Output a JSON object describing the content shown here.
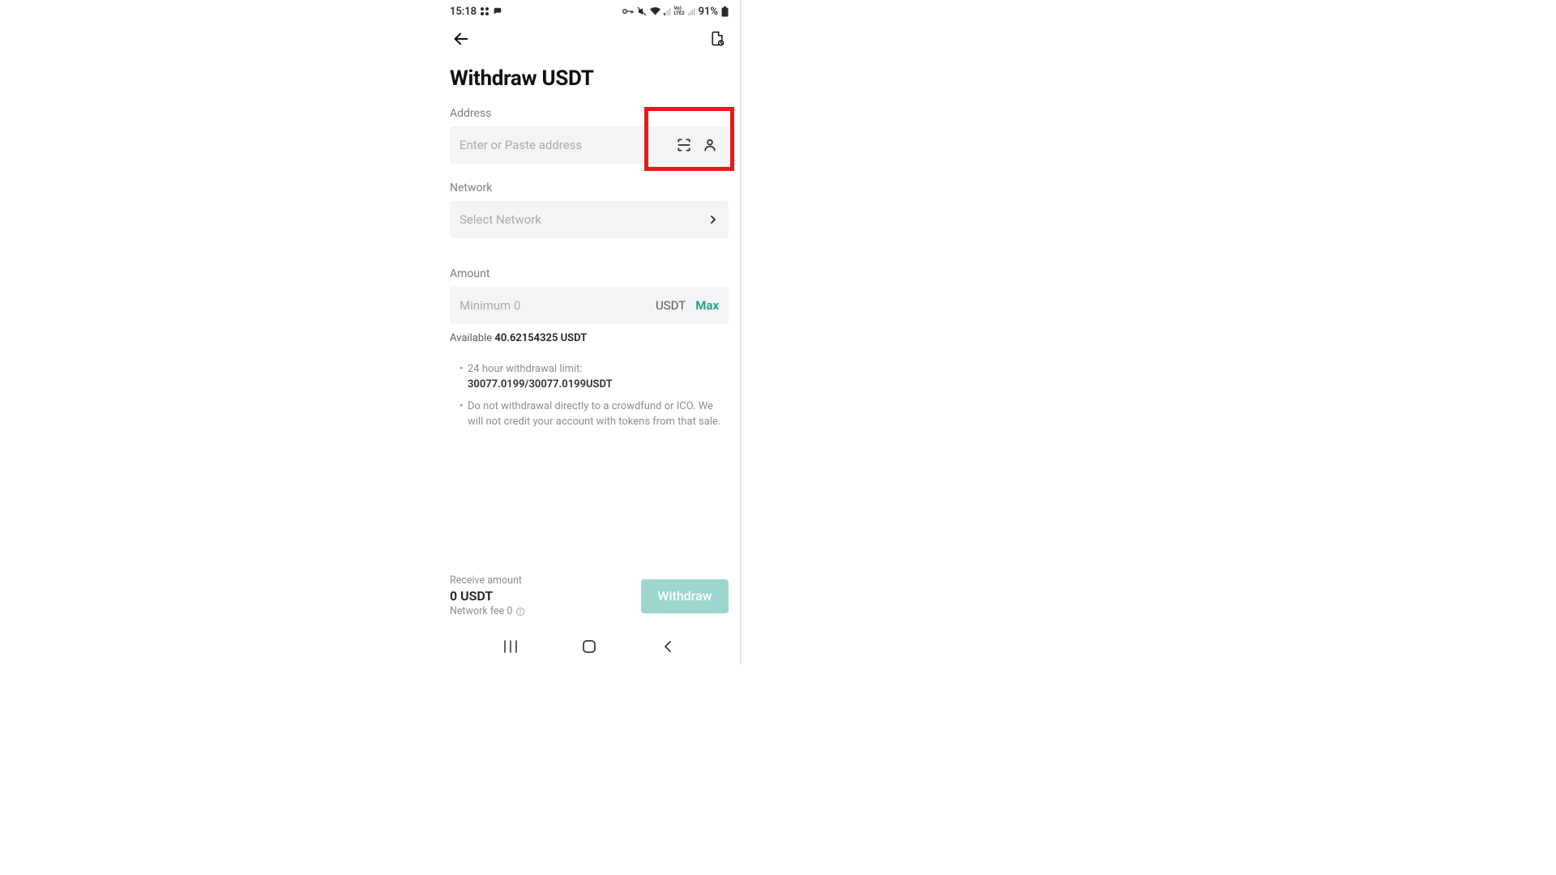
{
  "statusbar": {
    "time": "15:18",
    "battery_text": "91%"
  },
  "header": {
    "page_title": "Withdraw USDT"
  },
  "address": {
    "label": "Address",
    "placeholder": "Enter or Paste address"
  },
  "network": {
    "label": "Network",
    "placeholder": "Select Network"
  },
  "amount": {
    "label": "Amount",
    "placeholder": "Minimum 0",
    "unit": "USDT",
    "max_label": "Max",
    "available_prefix": "Available ",
    "available_value": "40.62154325 USDT"
  },
  "notes": {
    "limit_prefix": "24 hour withdrawal limit: ",
    "limit_value": "30077.0199/30077.0199USDT",
    "ico_warning": "Do not withdrawal directly to a crowdfund or ICO. We will not credit your account with tokens from that sale."
  },
  "bottom": {
    "receive_label": "Receive amount",
    "receive_value": "0 USDT",
    "fee_label": "Network fee 0",
    "withdraw_button": "Withdraw"
  },
  "colors": {
    "accent": "#1aa185",
    "button_bg": "#9cd6ce",
    "field_bg": "#f3f4f6",
    "highlight": "#ea1a1a"
  }
}
